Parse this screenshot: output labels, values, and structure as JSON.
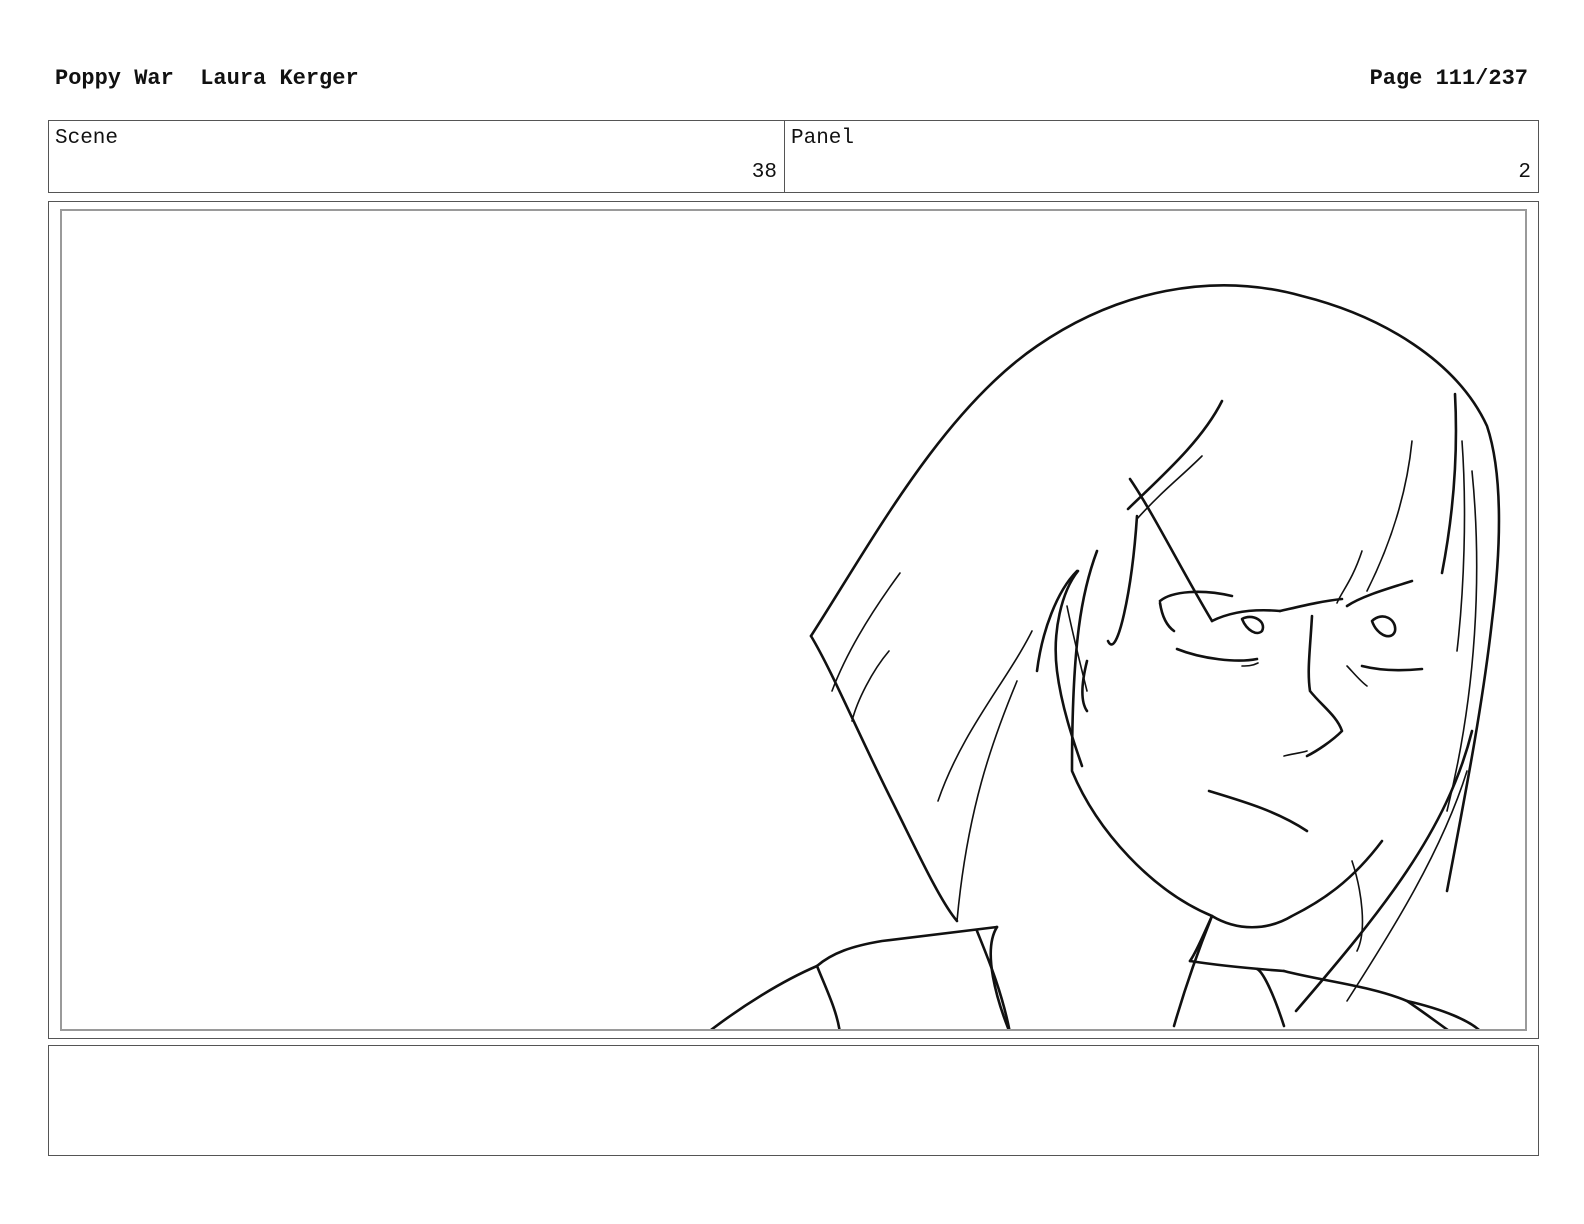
{
  "header": {
    "title": "Poppy War",
    "author": "Laura Kerger",
    "page": "Page 111/237"
  },
  "scene": {
    "label": "Scene",
    "value": "38"
  },
  "panel": {
    "label": "Panel",
    "value": "2"
  },
  "notes": {
    "text": ""
  }
}
